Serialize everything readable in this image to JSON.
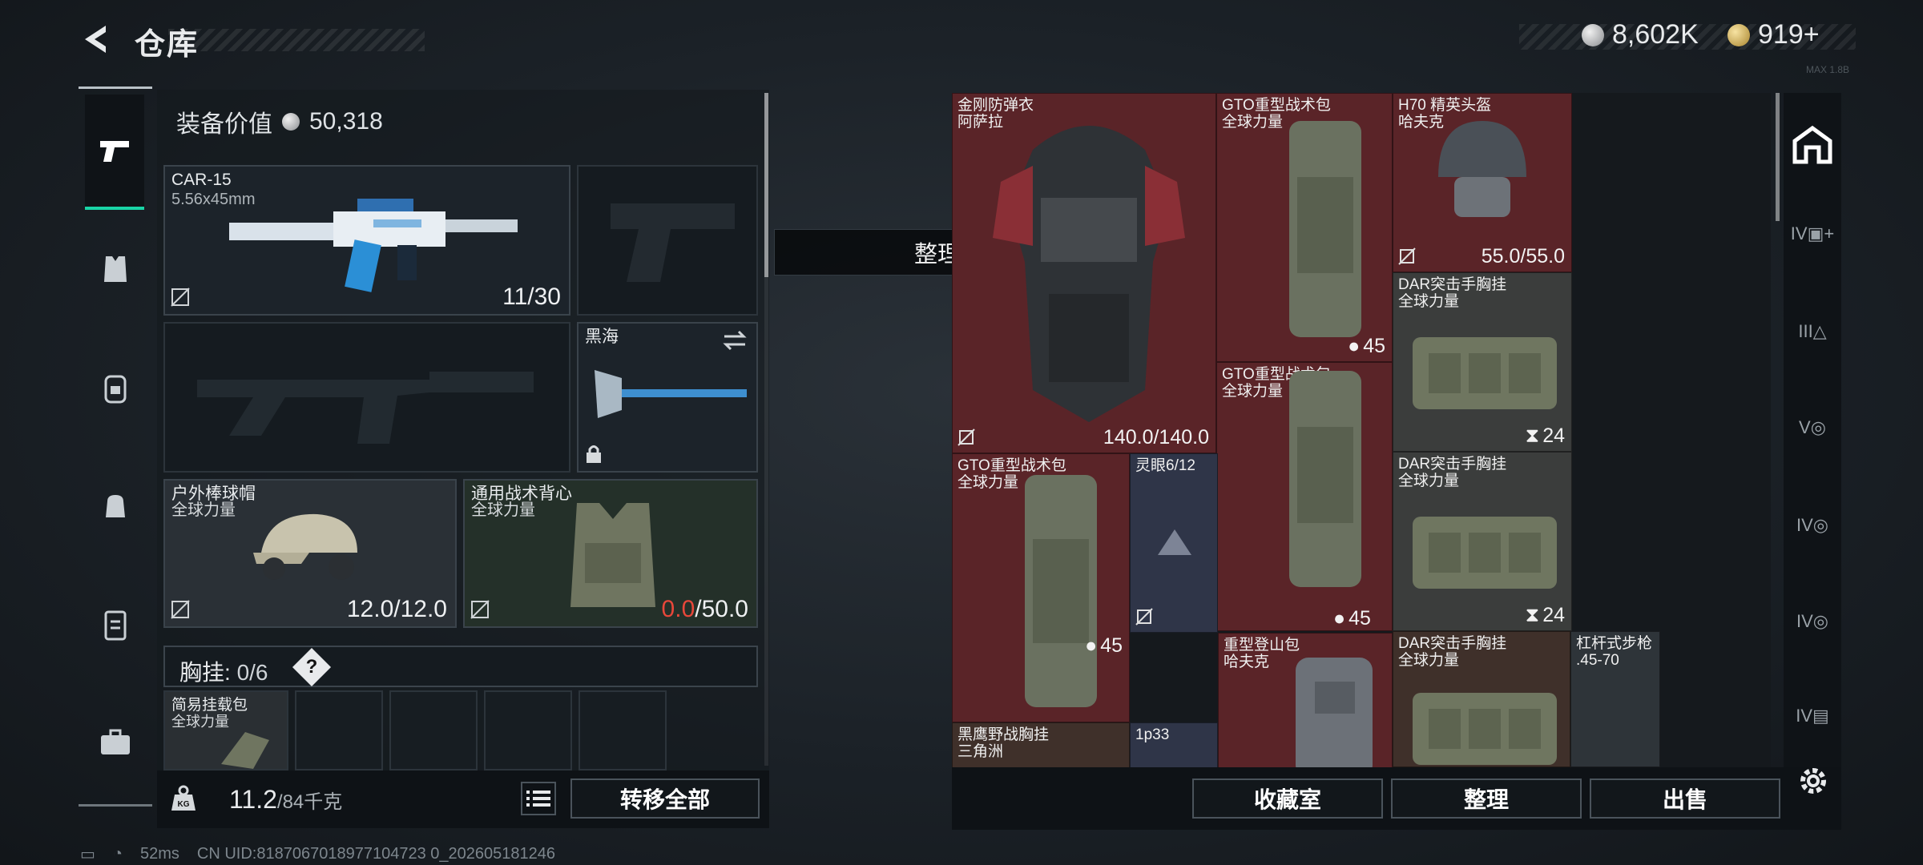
{
  "header": {
    "title": "仓库",
    "currency_silver": "8,602K",
    "currency_gold": "919+",
    "watermark": "MAX 1.8B"
  },
  "equipment": {
    "value_label": "装备价值",
    "value": "50,318",
    "primary_weapon": {
      "name": "CAR-15",
      "caliber": "5.56x45mm",
      "ammo": "11/30"
    },
    "melee": {
      "name": "黑海"
    },
    "helmet": {
      "name": "户外棒球帽",
      "faction": "全球力量",
      "durability": "12.0/12.0"
    },
    "armor": {
      "name": "通用战术背心",
      "faction": "全球力量",
      "durability_current": "0.0",
      "durability_max": "/50.0"
    },
    "chest_rig": {
      "label": "胸挂:",
      "count": "0/6",
      "help": "?"
    },
    "chest_item": {
      "name": "简易挂载包",
      "faction": "全球力量"
    }
  },
  "weight": {
    "current": "11.2",
    "total": "/84千克",
    "kg_icon": "KG"
  },
  "buttons": {
    "transfer_all": "转移全部",
    "collection": "收藏室",
    "sort": "整理",
    "sell": "出售"
  },
  "toast": "整理成功",
  "storage_items": [
    {
      "name": "金刚防弹衣",
      "sub": "阿萨拉",
      "value": "140.0/140.0"
    },
    {
      "name": "GTO重型战术包",
      "sub": "全球力量",
      "count": "45"
    },
    {
      "name": "H70 精英头盔",
      "sub": "哈夫克",
      "value": "55.0/55.0"
    },
    {
      "name": "DAR突击手胸挂",
      "sub": "全球力量",
      "count": "24"
    },
    {
      "name": "GTO重型战术包",
      "sub": "全球力量",
      "count": "45"
    },
    {
      "name": "GTO重型战术包",
      "sub": "全球力量",
      "count": "45"
    },
    {
      "name": "灵眼6/12",
      "sub": ""
    },
    {
      "name": "DAR突击手胸挂",
      "sub": "全球力量",
      "count": "24"
    },
    {
      "name": "重型登山包",
      "sub": "哈夫克"
    },
    {
      "name": "DAR突击手胸挂",
      "sub": "全球力量"
    },
    {
      "name": "杠杆式步枪",
      "sub": ".45-70"
    },
    {
      "name": "黑鹰野战胸挂",
      "sub": "三角洲"
    },
    {
      "name": "1p33",
      "sub": ""
    }
  ],
  "rail": {
    "labels": [
      "IV",
      "III",
      "V",
      "IV",
      "IV",
      "IV"
    ]
  },
  "status": {
    "ping": "52ms",
    "uid": "CN UID:8187067018977104723 0_202605181246"
  },
  "colors": {
    "accent": "#19d4a6",
    "item_red": "#5a2428",
    "alert": "#e8473a"
  }
}
